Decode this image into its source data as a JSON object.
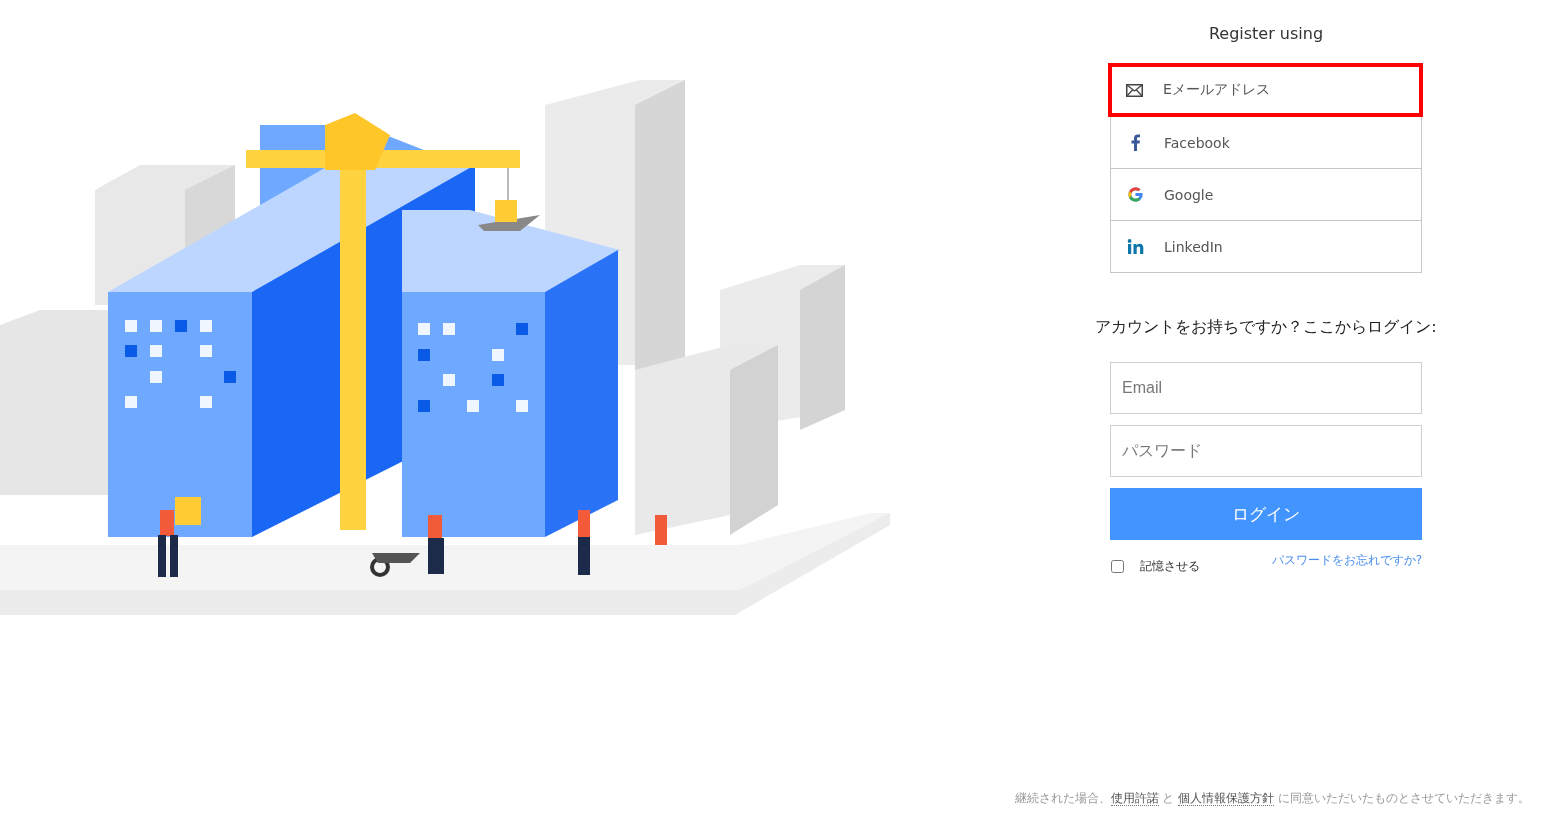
{
  "register": {
    "title": "Register using",
    "options": [
      {
        "kind": "email",
        "label": "Eメールアドレス",
        "highlighted": true
      },
      {
        "kind": "facebook",
        "label": "Facebook",
        "highlighted": false
      },
      {
        "kind": "google",
        "label": "Google",
        "highlighted": false
      },
      {
        "kind": "linkedin",
        "label": "LinkedIn",
        "highlighted": false
      }
    ]
  },
  "login": {
    "heading": "アカウントをお持ちですか？ここからログイン:",
    "email": {
      "placeholder": "Email"
    },
    "password": {
      "placeholder": "パスワード"
    },
    "button": "ログイン",
    "remember": {
      "label": "記憶させる",
      "checked": false
    },
    "forgot_link": "パスワードをお忘れですか?"
  },
  "footer": {
    "before": "継続された場合、",
    "terms_link": "使用許諾",
    "between": "と",
    "privacy_link": "個人情報保護方針",
    "after": "に同意いただいたものとさせていただきます。"
  }
}
